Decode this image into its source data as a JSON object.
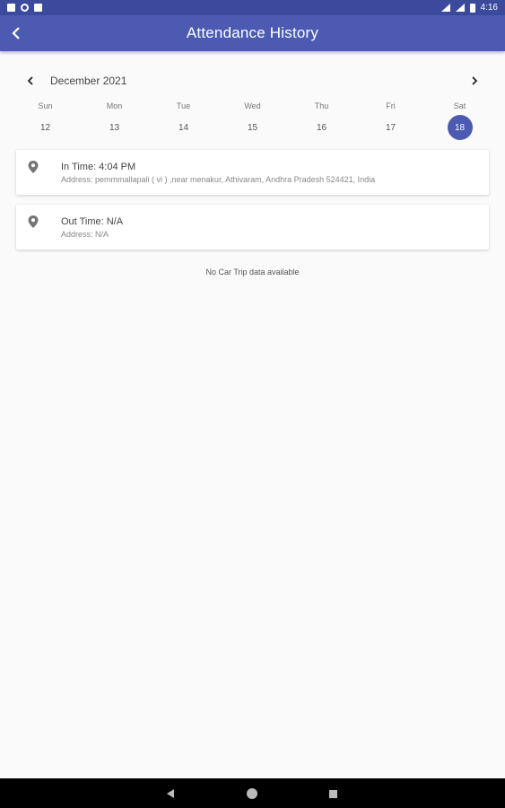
{
  "status_bar": {
    "time": "4:16"
  },
  "app_bar": {
    "title": "Attendance History",
    "back_icon": "back-arrow-icon"
  },
  "calendar": {
    "month": "December 2021",
    "days": [
      {
        "dow": "Sun",
        "date": "12"
      },
      {
        "dow": "Mon",
        "date": "13"
      },
      {
        "dow": "Tue",
        "date": "14"
      },
      {
        "dow": "Wed",
        "date": "15"
      },
      {
        "dow": "Thu",
        "date": "16"
      },
      {
        "dow": "Fri",
        "date": "17"
      },
      {
        "dow": "Sat",
        "date": "18"
      }
    ],
    "selected_date": "18"
  },
  "in_card": {
    "title": "In Time: 4:04 PM",
    "address": "Address: pemmmallapali ( vi ) ,near menakur, Athivaram, Andhra Pradesh 524421, India"
  },
  "out_card": {
    "title": "Out Time: N/A",
    "address": "Address: N/A"
  },
  "empty_message": "No Car Trip data available",
  "colors": {
    "primary": "#4c5bb1",
    "status_bar": "#3b4a9c",
    "background": "#fafafa"
  }
}
